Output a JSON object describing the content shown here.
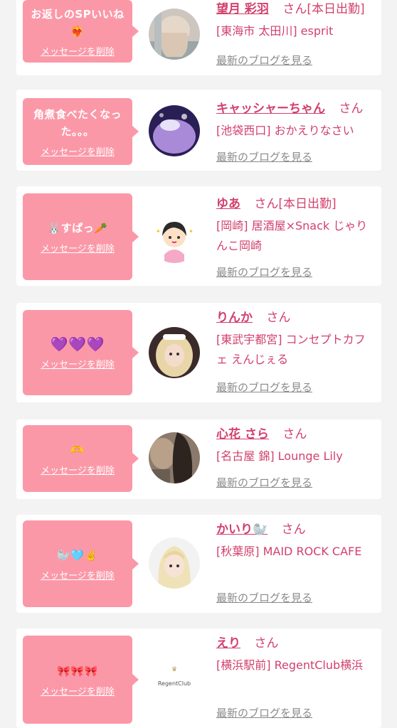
{
  "colors": {
    "accent": "#d2406d",
    "bubble": "#fb98a8",
    "link_gray": "#8a8a8a"
  },
  "delete_label": "メッセージを削除",
  "blog_label": "最新のブログを見る",
  "san_label": "さん",
  "entries": [
    {
      "message": "お返しのSPいいね❤️‍🔥",
      "name": "望月 彩羽",
      "tag": "[本日出勤]",
      "shop": "[東海市 太田川] esprit",
      "avatar": "hair-photo-icon"
    },
    {
      "message": "角煮食べたくなった。。。",
      "name": "キャッシャーちゃん",
      "tag": "",
      "shop": "[池袋西口] おかえりなさい",
      "avatar": "purple-drink-photo-icon"
    },
    {
      "message": "🐰すぱっ🥕",
      "name": "ゆあ",
      "tag": "[本日出勤]",
      "shop": "[岡崎] 居酒屋×Snack じゃりんこ岡崎",
      "avatar": "cartoon-girl-icon"
    },
    {
      "message": "💜💜💜",
      "name": "りんか",
      "tag": "",
      "shop": "[東武宇都宮] コンセプトカフェ えんじぇる",
      "avatar": "blonde-girl-photo-icon"
    },
    {
      "message": "🫶",
      "name": "心花 さら",
      "tag": "",
      "shop": "[名古屋 錦] Lounge Lily",
      "avatar": "dark-hair-photo-icon"
    },
    {
      "message": "🦭🩵✌️",
      "name": "かいり🦭",
      "tag": "",
      "shop": "[秋葉原] MAID ROCK CAFE",
      "avatar": "blonde-bangs-photo-icon"
    },
    {
      "message": "🎀🎀🎀",
      "name": "えり",
      "tag": "",
      "shop": "[横浜駅前] RegentClub横浜",
      "avatar": "regent-club-logo-icon",
      "logo_text": "RegentClub"
    }
  ]
}
